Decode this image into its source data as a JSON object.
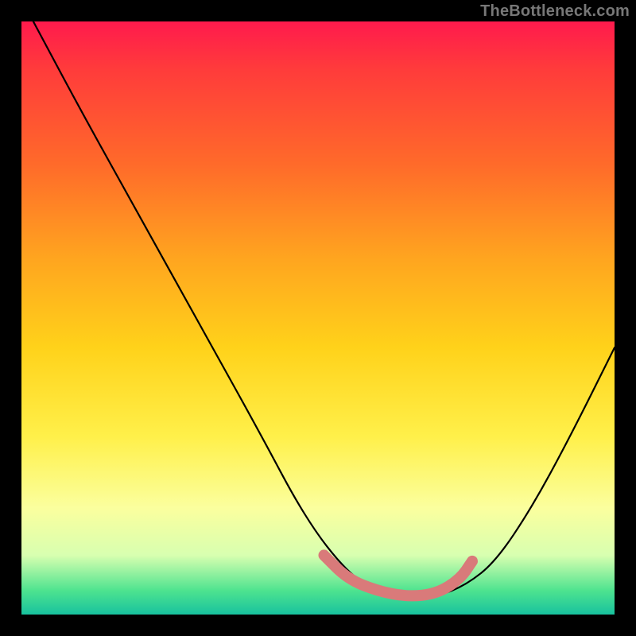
{
  "watermark": "TheBottleneck.com",
  "colors": {
    "frame": "#000000",
    "curve_stroke": "#000000",
    "trough_stroke": "#d97a7a",
    "gradient_stops": [
      "#ff1a4d",
      "#ff3b3b",
      "#ff6a2a",
      "#ffa51f",
      "#ffd21a",
      "#fff04a",
      "#fbff9e",
      "#d8ffb0",
      "#4de38f",
      "#18c29e"
    ]
  },
  "chart_data": {
    "type": "line",
    "title": "",
    "xlabel": "",
    "ylabel": "",
    "xlim": [
      0,
      100
    ],
    "ylim": [
      0,
      100
    ],
    "grid": false,
    "legend": false,
    "annotations": [
      "TheBottleneck.com"
    ],
    "series": [
      {
        "name": "bottleneck-curve",
        "x": [
          2,
          10,
          20,
          30,
          40,
          48,
          55,
          60,
          65,
          70,
          75,
          80,
          86,
          92,
          100
        ],
        "y": [
          100,
          85,
          67,
          49,
          31,
          16,
          7,
          4,
          3,
          3,
          5,
          9,
          18,
          29,
          45
        ]
      }
    ],
    "trough_highlight": {
      "name": "pink-trough-segment",
      "x": [
        51,
        55,
        60,
        65,
        70,
        74,
        76
      ],
      "y": [
        10,
        6,
        4,
        3,
        3.5,
        6,
        9
      ]
    }
  }
}
